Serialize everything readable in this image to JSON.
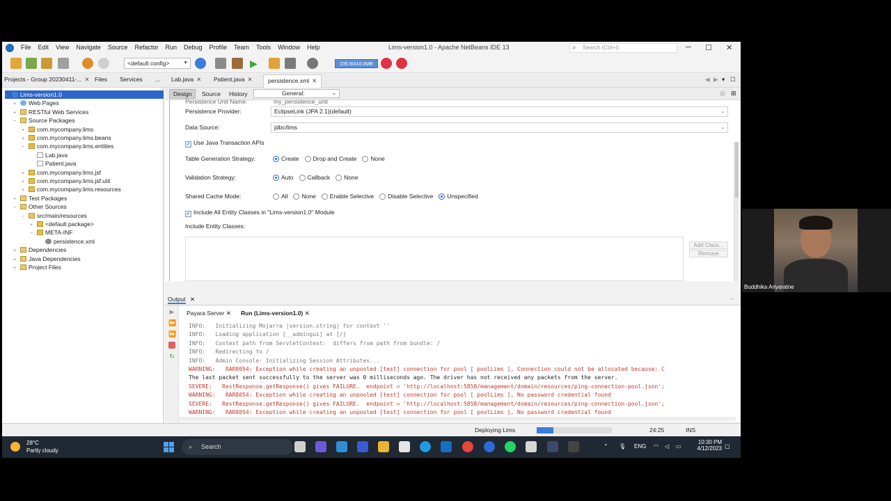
{
  "window": {
    "title": "Lims-version1.0 - Apache NetBeans IDE 13",
    "search_placeholder": "Search (Ctrl+I)"
  },
  "menu": [
    "File",
    "Edit",
    "View",
    "Navigate",
    "Source",
    "Refactor",
    "Run",
    "Debug",
    "Profile",
    "Team",
    "Tools",
    "Window",
    "Help"
  ],
  "toolbar": {
    "config": "<default config>",
    "memory": "235.9/410.0MB"
  },
  "left_tabs": {
    "projects": "Projects - Group 20230411-...",
    "files": "Files",
    "services": "Services",
    "more": "..."
  },
  "editor_tabs": [
    "Lab.java",
    "Patient.java",
    "persistence.xml"
  ],
  "project_tree": [
    {
      "label": "Lims-version1.0",
      "indent": 0,
      "icon": "proj",
      "toggle": "−",
      "selected": true
    },
    {
      "label": "Web Pages",
      "indent": 1,
      "icon": "web",
      "toggle": "+"
    },
    {
      "label": "RESTful Web Services",
      "indent": 1,
      "icon": "folder",
      "toggle": "+"
    },
    {
      "label": "Source Packages",
      "indent": 1,
      "icon": "folder",
      "toggle": "−"
    },
    {
      "label": "com.mycompany.lims",
      "indent": 2,
      "icon": "pkg",
      "toggle": "+"
    },
    {
      "label": "com.mycompany.lims.beans",
      "indent": 2,
      "icon": "pkg",
      "toggle": "+"
    },
    {
      "label": "com.mycompany.lims.entities",
      "indent": 2,
      "icon": "pkg",
      "toggle": "−"
    },
    {
      "label": "Lab.java",
      "indent": 3,
      "icon": "file",
      "toggle": ""
    },
    {
      "label": "Patient.java",
      "indent": 3,
      "icon": "file",
      "toggle": ""
    },
    {
      "label": "com.mycompany.lims.jsf",
      "indent": 2,
      "icon": "pkg",
      "toggle": "+"
    },
    {
      "label": "com.mycompany.lims.jsf.util",
      "indent": 2,
      "icon": "pkg",
      "toggle": "+"
    },
    {
      "label": "com.mycompany.lims.resources",
      "indent": 2,
      "icon": "pkg",
      "toggle": "+"
    },
    {
      "label": "Test Packages",
      "indent": 1,
      "icon": "folder",
      "toggle": "+"
    },
    {
      "label": "Other Sources",
      "indent": 1,
      "icon": "folder",
      "toggle": "−"
    },
    {
      "label": "src/main/resources",
      "indent": 2,
      "icon": "folder",
      "toggle": "−"
    },
    {
      "label": "<default package>",
      "indent": 3,
      "icon": "pkg",
      "toggle": "+"
    },
    {
      "label": "META-INF",
      "indent": 3,
      "icon": "pkg",
      "toggle": "−"
    },
    {
      "label": "persistence.xml",
      "indent": 4,
      "icon": "gear",
      "toggle": ""
    },
    {
      "label": "Dependencies",
      "indent": 1,
      "icon": "folder",
      "toggle": "+"
    },
    {
      "label": "Java Dependencies",
      "indent": 1,
      "icon": "folder",
      "toggle": "+"
    },
    {
      "label": "Project Files",
      "indent": 1,
      "icon": "folder",
      "toggle": "+"
    }
  ],
  "editor": {
    "view_tabs": [
      "Design",
      "Source",
      "History"
    ],
    "section": "General:",
    "unit_name_label": "Persistence Unit Name:",
    "unit_name_value": "my_persistence_unit",
    "provider_label": "Persistence Provider:",
    "provider_value": "EclipseLink (JPA 2.1)(default)",
    "datasource_label": "Data Source:",
    "datasource_value": "jdbc/lims",
    "jta_label": "Use Java Transaction APIs",
    "table_gen_label": "Table Generation Strategy:",
    "table_gen_options": [
      "Create",
      "Drop and Create",
      "None"
    ],
    "validation_label": "Validation Strategy:",
    "validation_options": [
      "Auto",
      "Callback",
      "None"
    ],
    "cache_label": "Shared Cache Mode:",
    "cache_options": [
      "All",
      "None",
      "Enable Selective",
      "Disable Selective",
      "Unspecified"
    ],
    "include_all_label": "Include All Entity Classes in \"Lims-version1.0\" Module",
    "include_entity_label": "Include Entity Classes:",
    "add_class": "Add Class...",
    "remove": "Remove"
  },
  "output": {
    "title": "Output",
    "tabs": [
      "Payara Server",
      "Run (Lims-version1.0)"
    ],
    "lines": [
      {
        "cls": "info",
        "text": "INFO:   Initializing Mojarra |version.string| for context ''"
      },
      {
        "cls": "info",
        "text": "INFO:   Loading application [__admingui] at [/]"
      },
      {
        "cls": "info",
        "text": "INFO:   Context path from ServletContext:  differs from path from bundle: /"
      },
      {
        "cls": "info",
        "text": "INFO:   Redirecting to /"
      },
      {
        "cls": "info",
        "text": "INFO:   Admin Console: Initializing Session Attributes..."
      },
      {
        "cls": "warn",
        "text": "WARNING:   RAR8054: Exception while creating an unpooled [test] connection for pool [ poolLims ], Connection could not be allocated because: C"
      },
      {
        "cls": "plain",
        "text": "The last packet sent successfully to the server was 0 milliseconds ago. The driver has not received any packets from the server."
      },
      {
        "cls": "warn",
        "text": "SEVERE:   RestResponse.getResponse() gives FAILURE.  endpoint = 'http://localhost:5858/management/domain/resources/ping-connection-pool.json';"
      },
      {
        "cls": "warn",
        "text": "WARNING:   RAR8054: Exception while creating an unpooled [test] connection for pool [ poolLims ], No password credential found"
      },
      {
        "cls": "warn",
        "text": "SEVERE:   RestResponse.getResponse() gives FAILURE.  endpoint = 'http://localhost:5858/management/domain/resources/ping-connection-pool.json';"
      },
      {
        "cls": "warn",
        "text": "WARNING:   RAR8054: Exception while creating an unpooled [test] connection for pool [ poolLims ], No password credential found"
      }
    ]
  },
  "status": {
    "task": "Deploying Lims",
    "progress": 0.22,
    "position": "24:25",
    "mode": "INS"
  },
  "webcam": {
    "name": "Buddhika Ariyaratne"
  },
  "taskbar": {
    "temp": "28°C",
    "weather": "Partly cloudy",
    "search": "Search",
    "lang": "ENG",
    "time": "10:30 PM",
    "date": "4/12/2023"
  }
}
